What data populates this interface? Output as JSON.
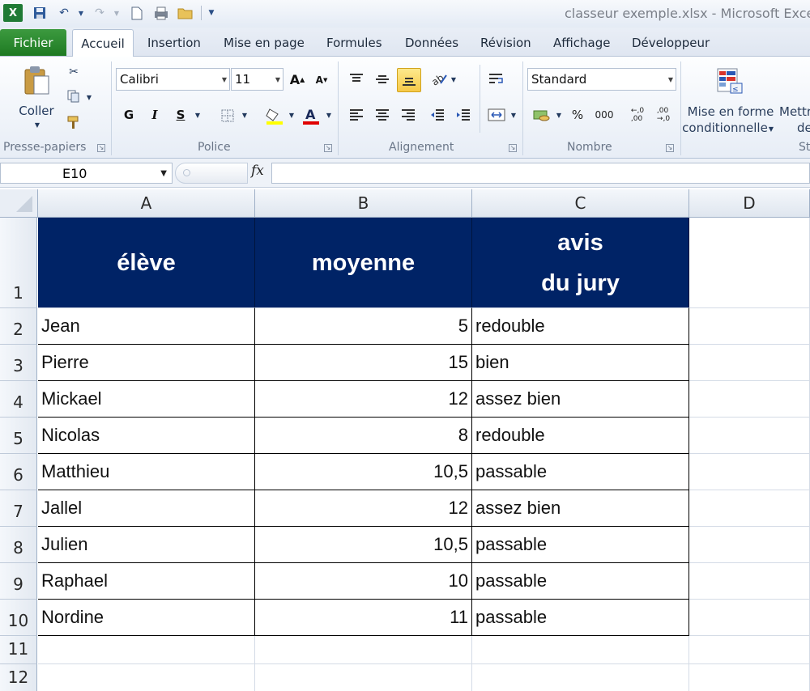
{
  "window": {
    "title": "classeur exemple.xlsx  -  Microsoft Excel"
  },
  "tabs": {
    "file": "Fichier",
    "items": [
      "Accueil",
      "Insertion",
      "Mise en page",
      "Formules",
      "Données",
      "Révision",
      "Affichage",
      "Développeur"
    ]
  },
  "ribbon": {
    "clipboard": {
      "paste": "Coller",
      "label": "Presse-papiers"
    },
    "font": {
      "name": "Calibri",
      "size": "11",
      "label": "Police",
      "bold": "G",
      "italic": "I",
      "underline": "S"
    },
    "alignment": {
      "label": "Alignement"
    },
    "number": {
      "format": "Standard",
      "label": "Nombre",
      "percent": "%",
      "thousands": "000"
    },
    "styles": {
      "conditional_line1": "Mise en forme",
      "conditional_line2": "conditionnelle",
      "format_table_partial1": "Mettr",
      "format_table_partial2": "de",
      "styles_partial": "St"
    }
  },
  "formula_bar": {
    "name_box": "E10",
    "fx": "fx",
    "formula": ""
  },
  "sheet": {
    "columns": [
      "A",
      "B",
      "C",
      "D"
    ],
    "rows": [
      "1",
      "2",
      "3",
      "4",
      "5",
      "6",
      "7",
      "8",
      "9",
      "10",
      "11",
      "12"
    ],
    "header": {
      "a": "élève",
      "b": "moyenne",
      "c1": "avis",
      "c2": "du jury"
    },
    "data": [
      {
        "eleve": "Jean",
        "moyenne": "5",
        "avis": "redouble"
      },
      {
        "eleve": "Pierre",
        "moyenne": "15",
        "avis": "bien"
      },
      {
        "eleve": "Mickael",
        "moyenne": "12",
        "avis": "assez bien"
      },
      {
        "eleve": "Nicolas",
        "moyenne": "8",
        "avis": "redouble"
      },
      {
        "eleve": "Matthieu",
        "moyenne": "10,5",
        "avis": "passable"
      },
      {
        "eleve": "Jallel",
        "moyenne": "12",
        "avis": "assez bien"
      },
      {
        "eleve": "Julien",
        "moyenne": "10,5",
        "avis": "passable"
      },
      {
        "eleve": "Raphael",
        "moyenne": "10",
        "avis": "passable"
      },
      {
        "eleve": "Nordine",
        "moyenne": "11",
        "avis": "passable"
      }
    ]
  },
  "colors": {
    "header_fill": "#002366",
    "file_tab": "#2a8a2e"
  }
}
